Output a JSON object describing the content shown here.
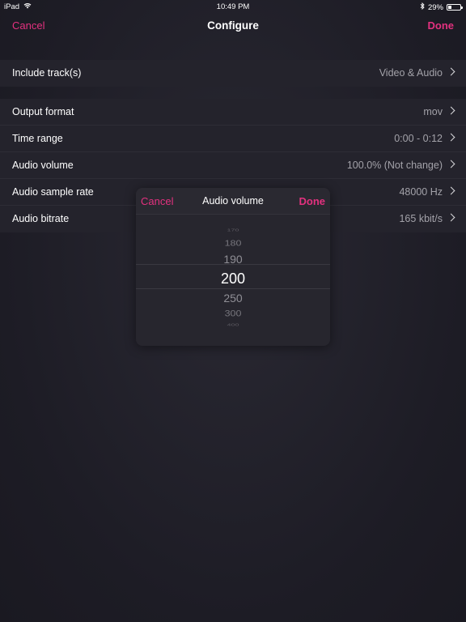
{
  "status_bar": {
    "device": "iPad",
    "time": "10:49 PM",
    "battery": "29%",
    "battery_level": 0.29
  },
  "nav": {
    "cancel": "Cancel",
    "title": "Configure",
    "done": "Done"
  },
  "settings": {
    "section1": [
      {
        "label": "Include track(s)",
        "value": "Video & Audio"
      }
    ],
    "section2": [
      {
        "label": "Output format",
        "value": "mov"
      },
      {
        "label": "Time range",
        "value": "0:00 - 0:12"
      },
      {
        "label": "Audio volume",
        "value": "100.0% (Not change)"
      },
      {
        "label": "Audio sample rate",
        "value": "48000 Hz"
      },
      {
        "label": "Audio bitrate",
        "value": "165 kbit/s"
      }
    ]
  },
  "popup": {
    "cancel": "Cancel",
    "title": "Audio volume",
    "done": "Done",
    "picker_values": [
      "170",
      "180",
      "190",
      "200",
      "250",
      "300",
      "400"
    ],
    "selected_value": "200"
  },
  "colors": {
    "accent": "#e3317f",
    "background": "#1f1e27",
    "row_background": "#24232c",
    "secondary_text": "#a3a2a9"
  }
}
